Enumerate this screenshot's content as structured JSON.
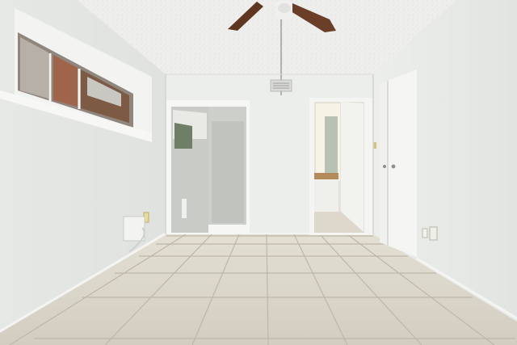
{
  "scene": {
    "subject": "empty-room-interior",
    "palette": {
      "ceiling": "#eeeeec",
      "wall": "#e7e9e6",
      "wall_shadow": "#d6d9d6",
      "floor": "#d9d5c9",
      "grout": "#b9b4a6",
      "door": "#f1f2ef",
      "window_glass": "#9e968e",
      "fan_blade": "#6a3e28",
      "vanity": "#b58a5a",
      "light_through": "#f6f2e6"
    },
    "objects": [
      "ceiling-fan-icon",
      "air-vent-icon",
      "window",
      "closet-mirror-door",
      "hallway-doorway",
      "closet-door",
      "wall-heater",
      "tile-floor"
    ]
  }
}
